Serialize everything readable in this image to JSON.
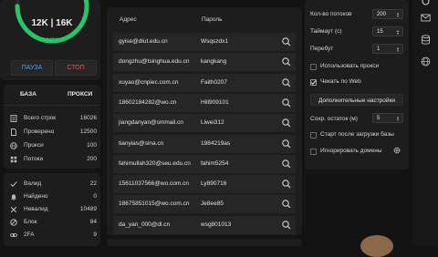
{
  "gauge": {
    "main": "12K | 16K",
    "sub": "2456",
    "progress_fraction": 0.75
  },
  "controls": {
    "pause_label": "ПАУЗА",
    "stop_label": "СТОП"
  },
  "tabs": {
    "db": "БАЗА",
    "proxy": "ПРОКСИ"
  },
  "stats": [
    {
      "icon": "list-icon",
      "label": "Всего строк",
      "value": "16026"
    },
    {
      "icon": "doc-icon",
      "label": "Проверено",
      "value": "12500"
    },
    {
      "icon": "globe-icon",
      "label": "Прокси",
      "value": "100"
    },
    {
      "icon": "grid-icon",
      "label": "Потоки",
      "value": "200"
    }
  ],
  "results": [
    {
      "icon": "check-icon",
      "label": "Валид",
      "value": "22"
    },
    {
      "icon": "bell-icon",
      "label": "Найдено",
      "value": "0"
    },
    {
      "icon": "close-icon",
      "label": "Невалид",
      "value": "10489"
    },
    {
      "icon": "block-icon",
      "label": "Блок",
      "value": "84"
    },
    {
      "icon": "link-icon",
      "label": "2FA",
      "value": "9"
    }
  ],
  "table": {
    "header_addr": "Адрес",
    "header_pass": "Пароль",
    "rows": [
      {
        "addr": "gyise@dlut.edu.cn",
        "pass": "Wsqszdx1"
      },
      {
        "addr": "dongzhu@tsinghua.edu.cn",
        "pass": "kangkang"
      },
      {
        "addr": "xuyao@cnpiec.com.cn",
        "pass": "Faith0207"
      },
      {
        "addr": "18602184282@wo.cn",
        "pass": "Hill909101"
      },
      {
        "addr": "jiangdanyan@smmail.cn",
        "pass": "Liwei312"
      },
      {
        "addr": "tianyias@sina.cn",
        "pass": "1984219as"
      },
      {
        "addr": "fahimullah320@seu.edu.cn",
        "pass": "fahim5254"
      },
      {
        "addr": "15611037566@wo.com.cn",
        "pass": "Ly890716"
      },
      {
        "addr": "18675851015@wo.com.cn",
        "pass": "Je8ee85"
      },
      {
        "addr": "da_yan_000@dl.cn",
        "pass": "wsg801013"
      }
    ]
  },
  "settings": {
    "threads_label": "Кол-во потоков",
    "threads_value": "200",
    "timeout_label": "Таймаут (с)",
    "timeout_value": "15",
    "retry_label": "Перебут",
    "retry_value": "1",
    "use_proxy_label": "Использовать прокси",
    "web_print_label": "Чекать по Web",
    "extra_label": "Дополнительные настройки",
    "save_rest_label": "Сохр. остаток (м)",
    "save_rest_value": "5",
    "start_after_load_label": "Старт после загрузки базы",
    "ignore_domains_label": "Игнорировать домены"
  },
  "colors": {
    "gauge_green": "#27c46a",
    "pause_blue": "#4aa0e6",
    "stop_red": "#e25555"
  }
}
